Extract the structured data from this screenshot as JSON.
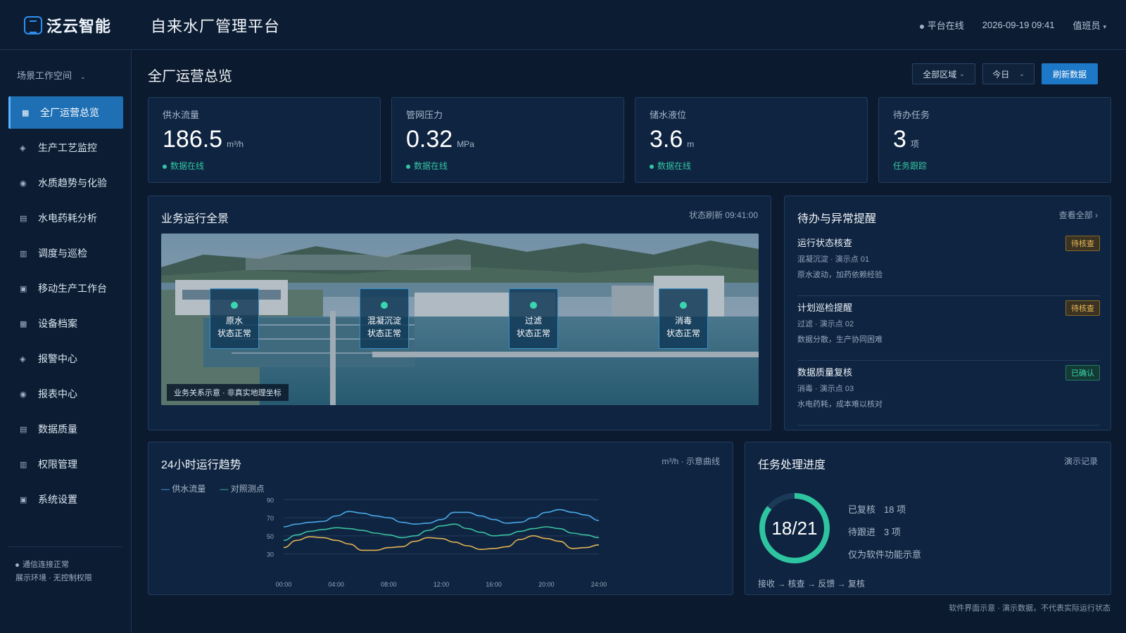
{
  "header": {
    "brand": "泛云智能",
    "app_title": "自来水厂管理平台",
    "status": "平台在线",
    "datetime": "2026-09-19 09:41",
    "user": "值班员"
  },
  "sidebar": {
    "workspace": "场景工作空间",
    "items": [
      {
        "label": "全厂运营总览",
        "icon": "grid-icon",
        "glyph": "▦"
      },
      {
        "label": "生产工艺监控",
        "icon": "diamond-icon",
        "glyph": "◈"
      },
      {
        "label": "水质趋势与化验",
        "icon": "circle-icon",
        "glyph": "◉"
      },
      {
        "label": "水电药耗分析",
        "icon": "list-icon",
        "glyph": "▤"
      },
      {
        "label": "调度与巡检",
        "icon": "table-icon",
        "glyph": "▥"
      },
      {
        "label": "移动生产工作台",
        "icon": "square-icon",
        "glyph": "▣"
      },
      {
        "label": "设备档案",
        "icon": "grid-icon",
        "glyph": "▦"
      },
      {
        "label": "报警中心",
        "icon": "diamond-icon",
        "glyph": "◈"
      },
      {
        "label": "报表中心",
        "icon": "circle-icon",
        "glyph": "◉"
      },
      {
        "label": "数据质量",
        "icon": "list-icon",
        "glyph": "▤"
      },
      {
        "label": "权限管理",
        "icon": "table-icon",
        "glyph": "▥"
      },
      {
        "label": "系统设置",
        "icon": "square-icon",
        "glyph": "▣"
      }
    ],
    "foot_status": "通信连接正常",
    "foot_note": "展示环境 · 无控制权限"
  },
  "main": {
    "title": "全厂运营总览",
    "filter_area": "全部区域",
    "filter_time": "今日",
    "refresh": "刷新数据"
  },
  "kpis": [
    {
      "label": "供水流量",
      "value": "186.5",
      "unit": "m³/h",
      "sub": "数据在线"
    },
    {
      "label": "管网压力",
      "value": "0.32",
      "unit": "MPa",
      "sub": "数据在线"
    },
    {
      "label": "储水液位",
      "value": "3.6",
      "unit": "m",
      "sub": "数据在线"
    },
    {
      "label": "待办任务",
      "value": "3",
      "unit": "项",
      "sub": "任务跟踪"
    }
  ],
  "overview": {
    "title": "业务运行全景",
    "meta": "状态刷新 09:41:00",
    "stages": [
      {
        "name": "原水",
        "status": "状态正常"
      },
      {
        "name": "混凝沉淀",
        "status": "状态正常"
      },
      {
        "name": "过滤",
        "status": "状态正常"
      },
      {
        "name": "消毒",
        "status": "状态正常"
      }
    ],
    "tag": "业务关系示意 · 非真实地理坐标"
  },
  "alerts": {
    "title": "待办与异常提醒",
    "view_all": "查看全部 ›",
    "items": [
      {
        "title": "运行状态核查",
        "line1": "混凝沉淀 · 演示点 01",
        "line2": "原水波动，加药依赖经验",
        "badge": "待核查"
      },
      {
        "title": "计划巡检提醒",
        "line1": "过滤 · 演示点 02",
        "line2": "数据分散，生产协同困难",
        "badge": "待核查"
      },
      {
        "title": "数据质量复核",
        "line1": "消毒 · 演示点 03",
        "line2": "水电药耗，成本难以核对",
        "badge": "已确认"
      }
    ]
  },
  "trend": {
    "title": "24小时运行趋势",
    "meta": "m³/h · 示意曲线"
  },
  "chart_data": {
    "type": "line",
    "title": "24小时运行趋势",
    "xlabel": "",
    "ylabel": "",
    "x": [
      "00:00",
      "01:00",
      "02:00",
      "03:00",
      "04:00",
      "05:00",
      "06:00",
      "07:00",
      "08:00",
      "09:00",
      "10:00",
      "11:00",
      "12:00",
      "13:00",
      "14:00",
      "15:00",
      "16:00",
      "17:00",
      "18:00",
      "19:00",
      "20:00",
      "21:00",
      "22:00",
      "23:00",
      "24:00"
    ],
    "tick_labels": [
      "00:00",
      "04:00",
      "08:00",
      "12:00",
      "16:00",
      "20:00",
      "24:00"
    ],
    "y_ticks": [
      90,
      70,
      50,
      30
    ],
    "ylim": [
      25,
      95
    ],
    "series": [
      {
        "name": "供水流量",
        "color": "#4aa8e8",
        "values": [
          60,
          63,
          65,
          66,
          72,
          77,
          75,
          72,
          70,
          65,
          63,
          64,
          68,
          76,
          76,
          72,
          68,
          64,
          65,
          70,
          76,
          79,
          76,
          73,
          67
        ]
      },
      {
        "name": "对照测点",
        "color": "#3cc0a0",
        "values": [
          45,
          51,
          55,
          57,
          59,
          58,
          56,
          53,
          51,
          48,
          50,
          56,
          61,
          63,
          58,
          54,
          50,
          51,
          55,
          58,
          60,
          58,
          53,
          51,
          48
        ]
      },
      {
        "name": "",
        "color": "#e0b255",
        "values": [
          37,
          45,
          49,
          48,
          45,
          41,
          34,
          34,
          37,
          38,
          44,
          48,
          47,
          43,
          39,
          35,
          36,
          38,
          46,
          50,
          47,
          44,
          36,
          37,
          40
        ]
      }
    ],
    "grid": true,
    "legend": "top-left"
  },
  "progress": {
    "title": "任务处理进度",
    "meta": "演示记录",
    "ratio_text": "18/21",
    "ratio": 0.857,
    "reviewed_label": "已复核",
    "reviewed_value": "18 项",
    "follow_label": "待跟进",
    "follow_value": "3 项",
    "note": "仅为软件功能示意",
    "flow": "接收 → 核查 → 反馈 → 复核"
  },
  "footnote": "软件界面示意 · 演示数据，不代表实际运行状态",
  "colors": {
    "accent": "#1e78c8",
    "ok": "#3ad6b0",
    "warn": "#e8b857"
  }
}
